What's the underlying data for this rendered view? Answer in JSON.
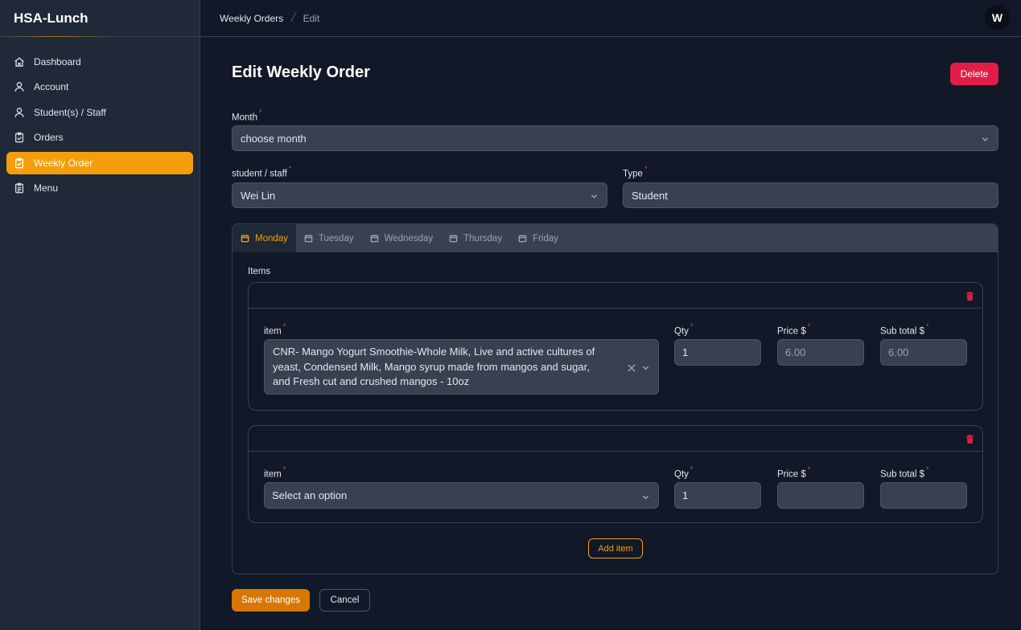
{
  "app": {
    "brand": "HSA-Lunch",
    "user_initial": "W"
  },
  "sidebar": {
    "items": [
      {
        "label": "Dashboard",
        "icon": "home-icon"
      },
      {
        "label": "Account",
        "icon": "user-icon"
      },
      {
        "label": "Student(s) / Staff",
        "icon": "user-icon"
      },
      {
        "label": "Orders",
        "icon": "clipboard-icon"
      },
      {
        "label": "Weekly Order",
        "icon": "clipboard-icon",
        "active": true
      },
      {
        "label": "Menu",
        "icon": "clipboard-list-icon"
      }
    ]
  },
  "breadcrumb": {
    "parent": "Weekly Orders",
    "current": "Edit"
  },
  "page": {
    "title": "Edit Weekly Order",
    "delete_label": "Delete"
  },
  "form": {
    "month": {
      "label": "Month",
      "placeholder": "choose month"
    },
    "student_staff": {
      "label": "student / staff",
      "value": "Wei Lin"
    },
    "type": {
      "label": "Type",
      "value": "Student"
    }
  },
  "tabs": [
    {
      "label": "Monday",
      "active": true
    },
    {
      "label": "Tuesday"
    },
    {
      "label": "Wednesday"
    },
    {
      "label": "Thursday"
    },
    {
      "label": "Friday"
    }
  ],
  "items_section": {
    "label": "Items",
    "col_item": "item",
    "col_qty": "Qty",
    "col_price": "Price $",
    "col_subtotal": "Sub total $",
    "rows": [
      {
        "item": "CNR- Mango Yogurt Smoothie-Whole Milk, Live and active cultures of yeast, Condensed Milk, Mango syrup made from mangos and sugar, and Fresh cut and crushed mangos - 10oz",
        "qty": "1",
        "price": "6.00",
        "subtotal": "6.00"
      },
      {
        "item_placeholder": "Select an option",
        "qty": "1",
        "price": "",
        "subtotal": ""
      }
    ],
    "add_label": "Add item"
  },
  "actions": {
    "save_label": "Save changes",
    "cancel_label": "Cancel"
  },
  "colors": {
    "accent": "#f59e0b",
    "danger": "#e11d48",
    "bg": "#111827",
    "sidebar": "#1f2937"
  }
}
